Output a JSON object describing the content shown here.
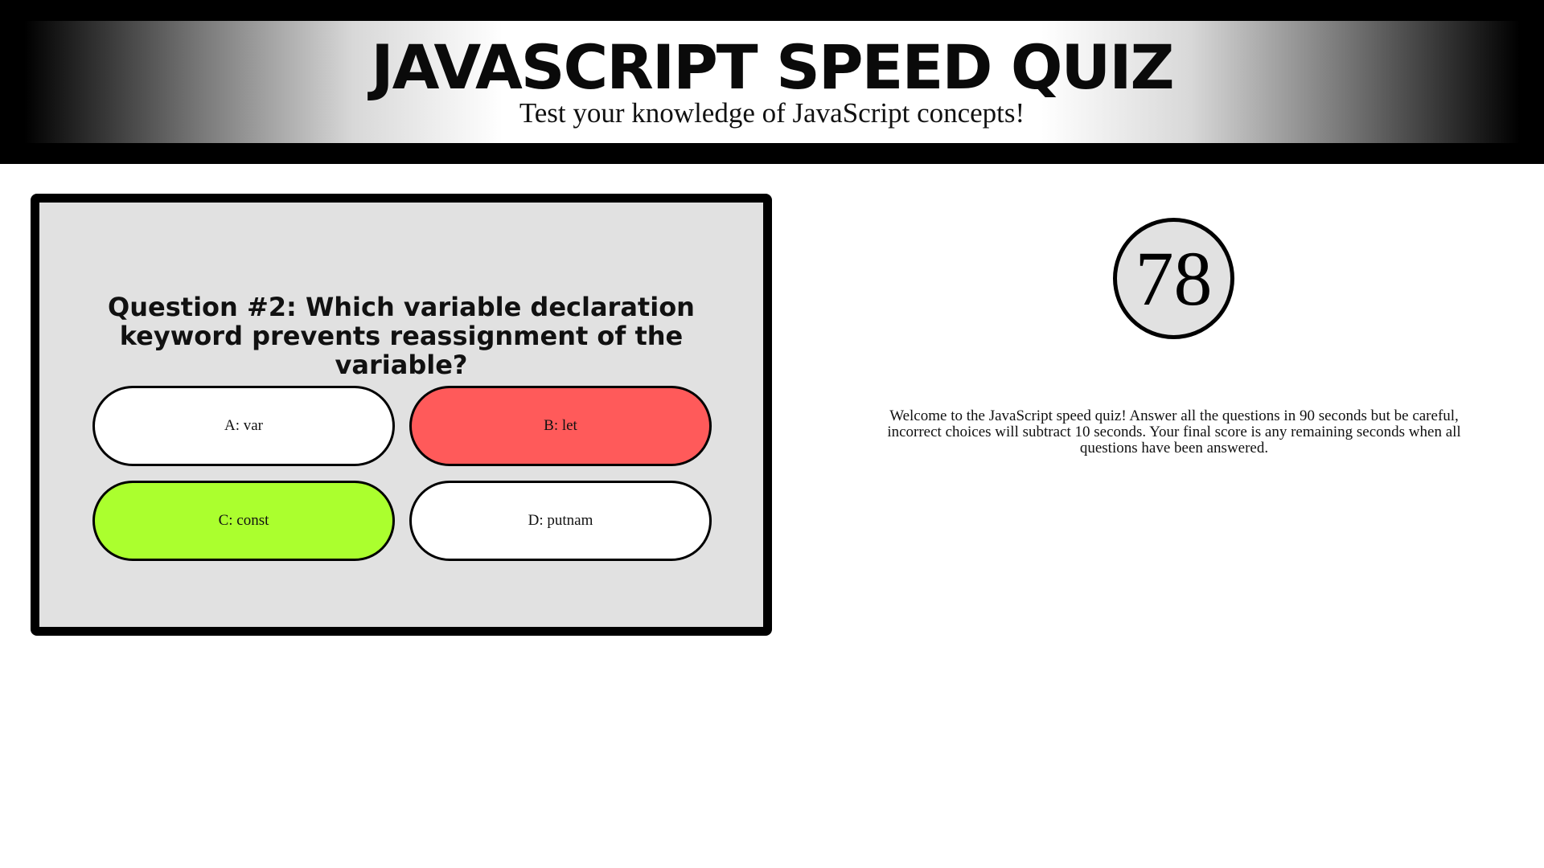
{
  "header": {
    "title": "JAVASCRIPT SPEED QUIZ",
    "subtitle": "Test your knowledge of JavaScript concepts!"
  },
  "quiz": {
    "question": "Question #2: Which variable declaration keyword prevents reassignment of the variable?",
    "answers": [
      {
        "label": "A: var",
        "state": "neutral",
        "color": "#ffffff"
      },
      {
        "label": "B: let",
        "state": "incorrect",
        "color": "#ff5a5a"
      },
      {
        "label": "C: const",
        "state": "correct",
        "color": "#abff2e"
      },
      {
        "label": "D: putnam",
        "state": "neutral",
        "color": "#ffffff"
      }
    ]
  },
  "timer": {
    "value": "78"
  },
  "instructions": {
    "text": "Welcome to the JavaScript speed quiz! Answer all the questions in 90 seconds but be careful, incorrect choices will subtract 10 seconds. Your final score is any remaining seconds when all questions have been answered."
  },
  "colors": {
    "card_background": "#e1e1e1",
    "border": "#000000",
    "incorrect": "#ff5a5a",
    "correct": "#abff2e"
  }
}
